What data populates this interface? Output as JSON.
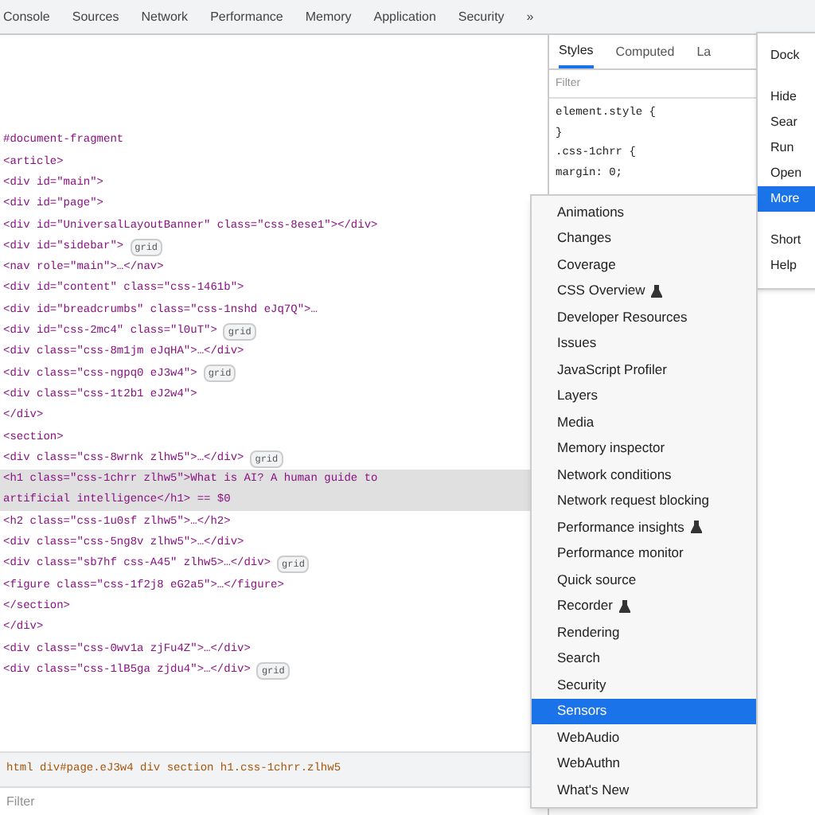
{
  "tabs": [
    {
      "label": "Console",
      "selected": false
    },
    {
      "label": "Sources",
      "selected": false
    },
    {
      "label": "Network",
      "selected": false
    },
    {
      "label": "Performance",
      "selected": false
    },
    {
      "label": "Memory",
      "selected": false
    },
    {
      "label": "Application",
      "selected": false
    },
    {
      "label": "Security",
      "selected": false
    },
    {
      "label": "»",
      "selected": false
    }
  ],
  "dom_lines": [
    {
      "text": "#document-fragment",
      "selected": false
    },
    {
      "text": "<article>",
      "selected": false
    },
    {
      "text": "<div id=\"main\">",
      "selected": false
    },
    {
      "text": "<div id=\"page\">",
      "selected": false
    },
    {
      "text": "<div id=\"UniversalLayoutBanner\" class=\"css-8ese1\"></div>",
      "selected": false
    },
    {
      "text": "<div id=\"sidebar\">",
      "badge": "grid",
      "selected": false
    },
    {
      "text": "<nav role=\"main\">…</nav>",
      "selected": false
    },
    {
      "text": "<div id=\"content\" class=\"css-1461b\">",
      "selected": false
    },
    {
      "text": "<div id=\"breadcrumbs\" class=\"css-1nshd eJq7Q\">…",
      "selected": false
    },
    {
      "text": "<div id=\"css-2mc4\" class=\"l0uT\">",
      "badge": "grid",
      "selected": false
    },
    {
      "text": "<div class=\"css-8m1jm eJqHA\">…</div>",
      "selected": false
    },
    {
      "text": "<div class=\"css-ngpq0 eJ3w4\">",
      "badge": "grid",
      "selected": false
    },
    {
      "text": "<div class=\"css-1t2b1 eJ2w4\">",
      "selected": false
    },
    {
      "text": "</div>",
      "selected": false
    },
    {
      "text": "<section>",
      "selected": false
    },
    {
      "text": "<div class=\"css-8wrnk zlhw5\">…</div>",
      "badge": "grid",
      "selected": false
    },
    {
      "text": "<h1 class=\"css-1chrr zlhw5\">What is AI? A human guide to",
      "selected": true
    },
    {
      "text": "artificial intelligence</h1> == $0",
      "selected": true
    },
    {
      "text": "<h2 class=\"css-1u0sf zlhw5\">…</h2>",
      "selected": false
    },
    {
      "text": "<div class=\"css-5ng8v zlhw5\">…</div>",
      "selected": false
    },
    {
      "text": "<div class=\"sb7hf css-A45\" zlhw5>…</div>",
      "badge": "grid",
      "selected": false
    },
    {
      "text": "<figure class=\"css-1f2j8 eG2a5\">…</figure>",
      "selected": false
    },
    {
      "text": "</section>",
      "selected": false
    },
    {
      "text": "</div>",
      "selected": false
    },
    {
      "text": "<div class=\"css-0wv1a zjFu4Z\">…</div>",
      "selected": false
    },
    {
      "text": "<div class=\"css-1lB5ga zjdu4\">…</div>",
      "badge": "grid",
      "selected": false
    }
  ],
  "breadcrumb": "html  div#page.eJ3w4  div  section  h1.css-1chrr.zlhw5",
  "bottom_filter": {
    "placeholder": "Filter"
  },
  "styles_tabs": [
    {
      "label": "Styles",
      "selected": true
    },
    {
      "label": "Computed",
      "selected": false
    },
    {
      "label": "La",
      "selected": false
    }
  ],
  "styles_filter": {
    "placeholder": "Filter"
  },
  "style_rules": [
    "element.style {",
    "}",
    ".css-1chrr {",
    "margin: 0;"
  ],
  "main_menu": [
    {
      "label": "Dock",
      "selected": false
    },
    {
      "label": "Hide",
      "selected": false
    },
    {
      "label": "Sear",
      "selected": false
    },
    {
      "label": "Run",
      "selected": false
    },
    {
      "label": "Open",
      "selected": false
    },
    {
      "label": "More",
      "selected": true
    },
    {
      "label": "Short",
      "selected": false
    },
    {
      "label": "Help",
      "selected": false
    }
  ],
  "more_tools": [
    {
      "label": "Animations",
      "experimental": false,
      "selected": false
    },
    {
      "label": "Changes",
      "experimental": false,
      "selected": false
    },
    {
      "label": "Coverage",
      "experimental": false,
      "selected": false
    },
    {
      "label": "CSS Overview",
      "experimental": true,
      "selected": false
    },
    {
      "label": "Developer Resources",
      "experimental": false,
      "selected": false
    },
    {
      "label": "Issues",
      "experimental": false,
      "selected": false
    },
    {
      "label": "JavaScript Profiler",
      "experimental": false,
      "selected": false
    },
    {
      "label": "Layers",
      "experimental": false,
      "selected": false
    },
    {
      "label": "Media",
      "experimental": false,
      "selected": false
    },
    {
      "label": "Memory inspector",
      "experimental": false,
      "selected": false
    },
    {
      "label": "Network conditions",
      "experimental": false,
      "selected": false
    },
    {
      "label": "Network request blocking",
      "experimental": false,
      "selected": false
    },
    {
      "label": "Performance insights",
      "experimental": true,
      "selected": false
    },
    {
      "label": "Performance monitor",
      "experimental": false,
      "selected": false
    },
    {
      "label": "Quick source",
      "experimental": false,
      "selected": false
    },
    {
      "label": "Recorder",
      "experimental": true,
      "selected": false
    },
    {
      "label": "Rendering",
      "experimental": false,
      "selected": false
    },
    {
      "label": "Search",
      "experimental": false,
      "selected": false
    },
    {
      "label": "Security",
      "experimental": false,
      "selected": false
    },
    {
      "label": "Sensors",
      "experimental": false,
      "selected": true
    },
    {
      "label": "WebAudio",
      "experimental": false,
      "selected": false
    },
    {
      "label": "WebAuthn",
      "experimental": false,
      "selected": false
    },
    {
      "label": "What's New",
      "experimental": false,
      "selected": false
    }
  ]
}
